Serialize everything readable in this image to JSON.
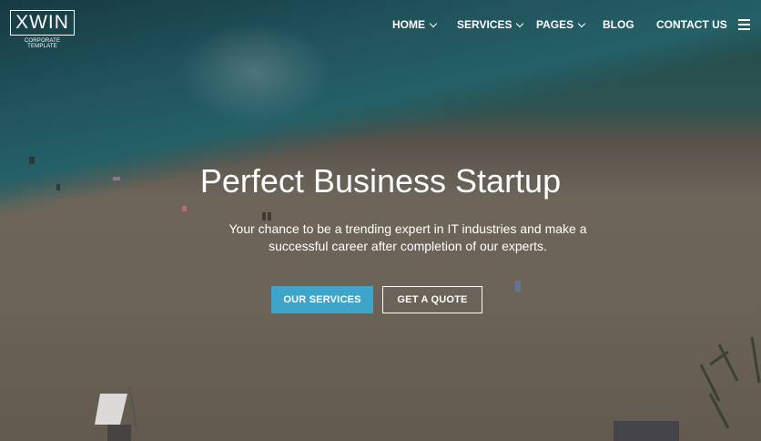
{
  "brand": {
    "name": "XWIN",
    "tagline": "CORPORATE TEMPLATE"
  },
  "nav": {
    "items": [
      {
        "label": "HOME",
        "dropdown": true
      },
      {
        "label": "SERVICES",
        "dropdown": true
      },
      {
        "label": "PAGES",
        "dropdown": true
      },
      {
        "label": "BLOG",
        "dropdown": false
      },
      {
        "label": "CONTACT US",
        "dropdown": false
      }
    ],
    "menu_icon": "hamburger-icon"
  },
  "hero": {
    "title_light_1": "Perfect ",
    "title_bold": "Business",
    "title_light_2": " Startup",
    "subtitle": "Your chance to be a trending expert in IT industries and make a successful career after completion of our experts.",
    "primary_button": "OUR SERVICES",
    "secondary_button": "GET A QUOTE"
  },
  "colors": {
    "accent": "#3fa4c9",
    "sea": "#2f7c83",
    "sand": "#8a7f70"
  }
}
